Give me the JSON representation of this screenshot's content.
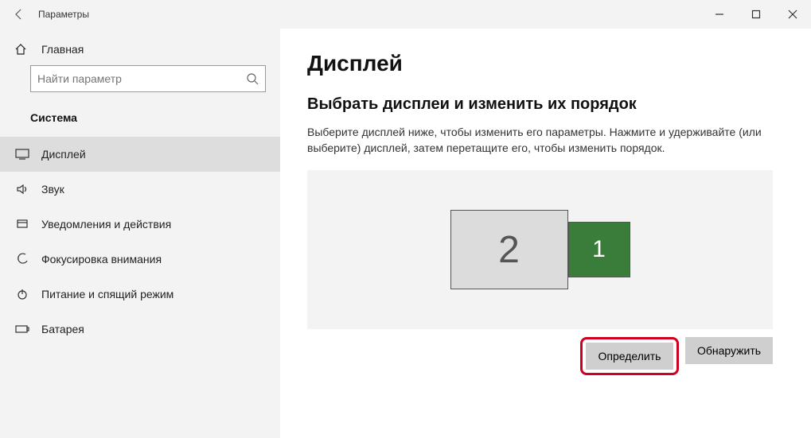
{
  "window": {
    "title": "Параметры",
    "minimize": "—",
    "maximize": "☐",
    "close": "✕"
  },
  "sidebar": {
    "home_label": "Главная",
    "search_placeholder": "Найти параметр",
    "section_label": "Система",
    "items": [
      {
        "label": "Дисплей"
      },
      {
        "label": "Звук"
      },
      {
        "label": "Уведомления и действия"
      },
      {
        "label": "Фокусировка внимания"
      },
      {
        "label": "Питание и спящий режим"
      },
      {
        "label": "Батарея"
      }
    ]
  },
  "main": {
    "page_title": "Дисплей",
    "subheading": "Выбрать дисплеи и изменить их порядок",
    "description": "Выберите дисплей ниже, чтобы изменить его параметры. Нажмите и удерживайте (или выберите) дисплей, затем перетащите его, чтобы изменить порядок.",
    "monitors": {
      "display1_label": "1",
      "display2_label": "2",
      "selected": 1
    },
    "identify_label": "Определить",
    "detect_label": "Обнаружить"
  },
  "colors": {
    "selected_monitor_bg": "#3a7d3a",
    "unselected_monitor_bg": "#dcdcdc",
    "highlight_border": "#d00020"
  }
}
